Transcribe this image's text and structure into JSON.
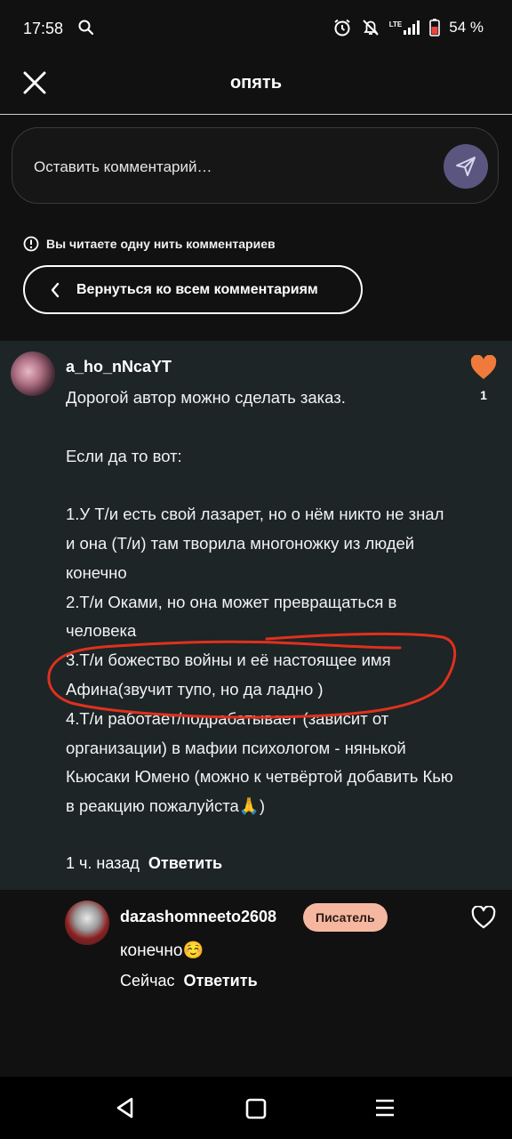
{
  "status_bar": {
    "time": "17:58",
    "battery": "54 %",
    "icons": [
      "search-icon",
      "alarm-icon",
      "mute-icon",
      "lte-signal-icon",
      "battery-icon"
    ],
    "lte_label": "LTE"
  },
  "header": {
    "title": "опять",
    "close_icon": "close-icon"
  },
  "comment_input": {
    "placeholder": "Оставить комментарий…",
    "send_icon": "send-icon"
  },
  "thread_notice": {
    "text": "Вы читаете одну нить комментариев",
    "icon": "info-icon"
  },
  "back_button": {
    "label": "Вернуться ко всем комментариям",
    "icon": "chevron-left-icon"
  },
  "main_comment": {
    "username": "a_ho_nNcaYT",
    "text": "Дорогой автор можно сделать заказ.\n\nЕсли да то вот:\n\n1.У  Т/и есть свой лазарет, но о нём никто не знал и она (Т/и) там творила многоножку из людей конечно\n2.Т/и Оками, но она может превращаться в человека\n3.Т/и божество войны и её настоящее имя Афина(звучит тупо, но да ладно )\n4.Т/и  работает/подрабатывает (зависит от организации) в мафии психологом - нянькой Кьюсаки Юмено (можно к четвёртой добавить Кью в реакцию пожалуйста🙏)",
    "time": "1 ч. назад",
    "reply_label": "Ответить",
    "likes": "1",
    "like_color": "#f07a3c"
  },
  "reply": {
    "username": "dazashomneeto2608",
    "badge": "Писатель",
    "badge_color": "#f6b7a0",
    "text": "конечно☺️",
    "time": "Сейчас",
    "reply_label": "Ответить"
  },
  "colors": {
    "background": "#111111",
    "comment_bg": "#1d2526",
    "send_button": "#5a5680",
    "highlight_stroke": "#e0301e"
  }
}
